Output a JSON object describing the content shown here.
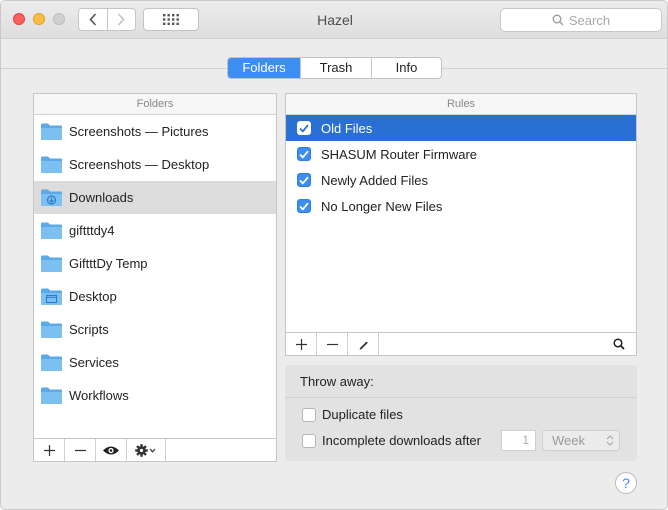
{
  "window": {
    "title": "Hazel",
    "search_placeholder": "Search"
  },
  "tabs": [
    {
      "label": "Folders",
      "active": true
    },
    {
      "label": "Trash",
      "active": false
    },
    {
      "label": "Info",
      "active": false
    }
  ],
  "folders_panel": {
    "header": "Folders",
    "items": [
      {
        "label": "Screenshots — Pictures",
        "icon": "folder-icon"
      },
      {
        "label": "Screenshots — Desktop",
        "icon": "folder-icon"
      },
      {
        "label": "Downloads",
        "icon": "downloads-folder-icon",
        "selected": true
      },
      {
        "label": "giftttdy4",
        "icon": "folder-icon"
      },
      {
        "label": "GiftttDy Temp",
        "icon": "folder-icon"
      },
      {
        "label": "Desktop",
        "icon": "desktop-folder-icon"
      },
      {
        "label": "Scripts",
        "icon": "folder-icon"
      },
      {
        "label": "Services",
        "icon": "folder-icon"
      },
      {
        "label": "Workflows",
        "icon": "folder-icon"
      }
    ]
  },
  "rules_panel": {
    "header": "Rules",
    "items": [
      {
        "label": "Old Files",
        "checked": true,
        "selected": true
      },
      {
        "label": "SHASUM Router Firmware",
        "checked": true
      },
      {
        "label": "Newly Added Files",
        "checked": true
      },
      {
        "label": "No Longer New Files",
        "checked": true
      }
    ]
  },
  "throw_away": {
    "header": "Throw away:",
    "duplicate_label": "Duplicate files",
    "incomplete_label": "Incomplete downloads after",
    "incomplete_count": "1",
    "incomplete_unit": "Week"
  },
  "help_label": "?",
  "colors": {
    "accent": "#3d8ef2",
    "selection": "#2a6fd4",
    "folder": "#6cb4ee"
  }
}
